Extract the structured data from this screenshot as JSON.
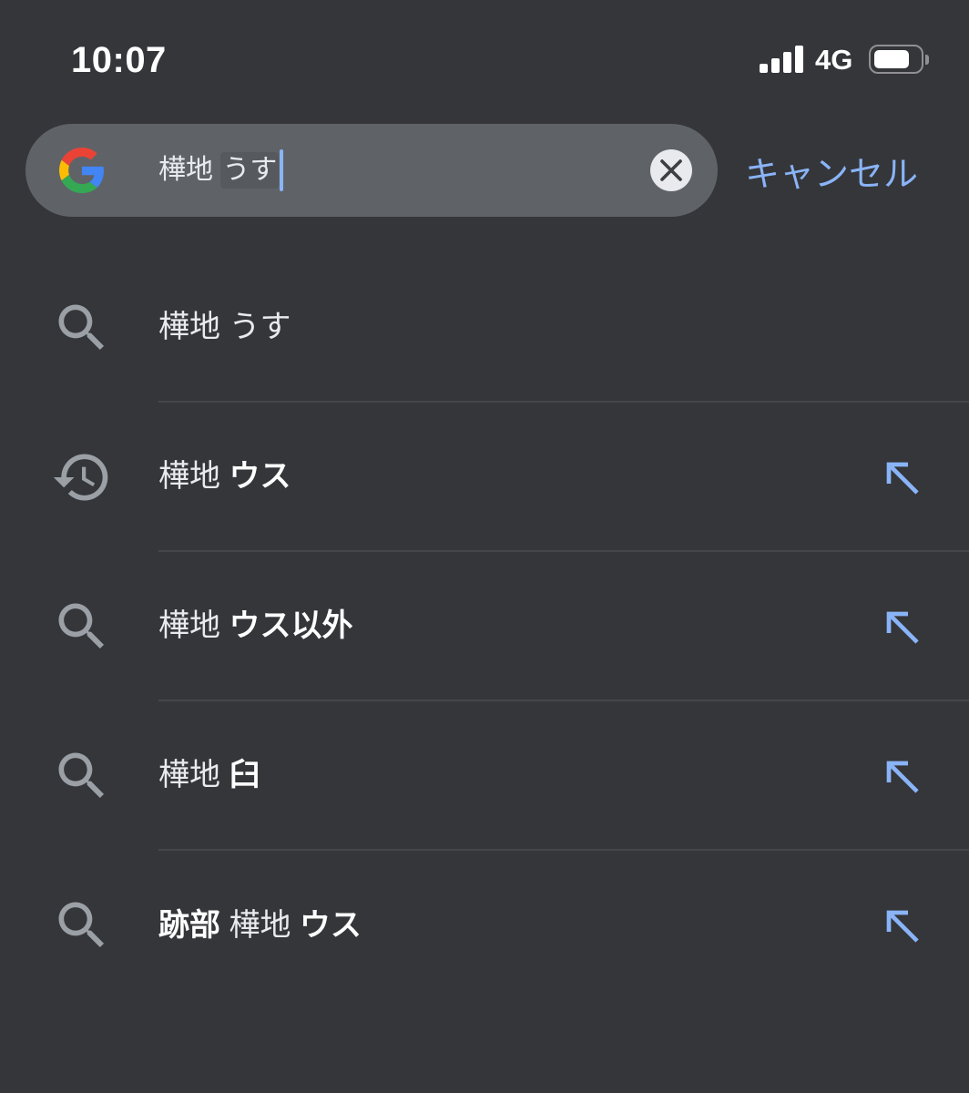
{
  "status_bar": {
    "time": "10:07",
    "signal_icon": "cellular-signal-icon",
    "signal_bars": 4,
    "network": "4G",
    "battery_icon": "battery-icon",
    "battery_level": 0.8
  },
  "search_bar": {
    "logo_icon": "google-g-logo",
    "query": {
      "committed": "樺地 ",
      "composing": "うす"
    },
    "clear_icon": "close-icon",
    "cancel_label": "キャンセル"
  },
  "suggestions": [
    {
      "icon": "search-icon",
      "segments": [
        {
          "text": "樺地 うす",
          "bold": false
        }
      ],
      "fill_arrow": false
    },
    {
      "icon": "history-icon",
      "segments": [
        {
          "text": "樺地 ",
          "bold": false
        },
        {
          "text": "ウス",
          "bold": true
        }
      ],
      "fill_arrow": true,
      "arrow_icon": "north-west-arrow-icon"
    },
    {
      "icon": "search-icon",
      "segments": [
        {
          "text": "樺地 ",
          "bold": false
        },
        {
          "text": "ウス以外",
          "bold": true
        }
      ],
      "fill_arrow": true,
      "arrow_icon": "north-west-arrow-icon"
    },
    {
      "icon": "search-icon",
      "segments": [
        {
          "text": "樺地 ",
          "bold": false
        },
        {
          "text": "臼",
          "bold": true
        }
      ],
      "fill_arrow": true,
      "arrow_icon": "north-west-arrow-icon"
    },
    {
      "icon": "search-icon",
      "segments": [
        {
          "text": "跡部",
          "bold": true
        },
        {
          "text": " 樺地 ",
          "bold": false
        },
        {
          "text": "ウス",
          "bold": true
        }
      ],
      "fill_arrow": true,
      "arrow_icon": "north-west-arrow-icon"
    }
  ],
  "colors": {
    "background": "#35363a",
    "search_bar": "#5f6368",
    "composing_highlight": "#565a5f",
    "text": "#e8eaed",
    "text_bold": "#ffffff",
    "status_text": "#ffffff",
    "icon": "#9aa0a6",
    "accent": "#8ab4f8",
    "divider": "#45464a",
    "clear_button": "#e8eaed",
    "clear_icon": "#3c4043",
    "brand_red": "#EA4335",
    "brand_blue": "#4285F4",
    "brand_yellow": "#FBBC05",
    "brand_green": "#34A853"
  }
}
